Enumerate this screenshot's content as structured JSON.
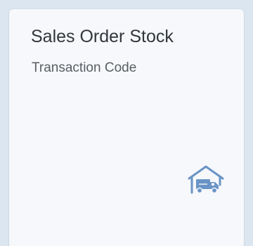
{
  "tile": {
    "title": "Sales Order Stock",
    "subtitle": "Transaction Code",
    "icon": "warehouse-truck-icon"
  },
  "colors": {
    "background": "#dbe6f1",
    "tile": "#f6f8fb",
    "title": "#32363a",
    "subtitle": "#5a5e62",
    "icon": "#6a94c6"
  }
}
